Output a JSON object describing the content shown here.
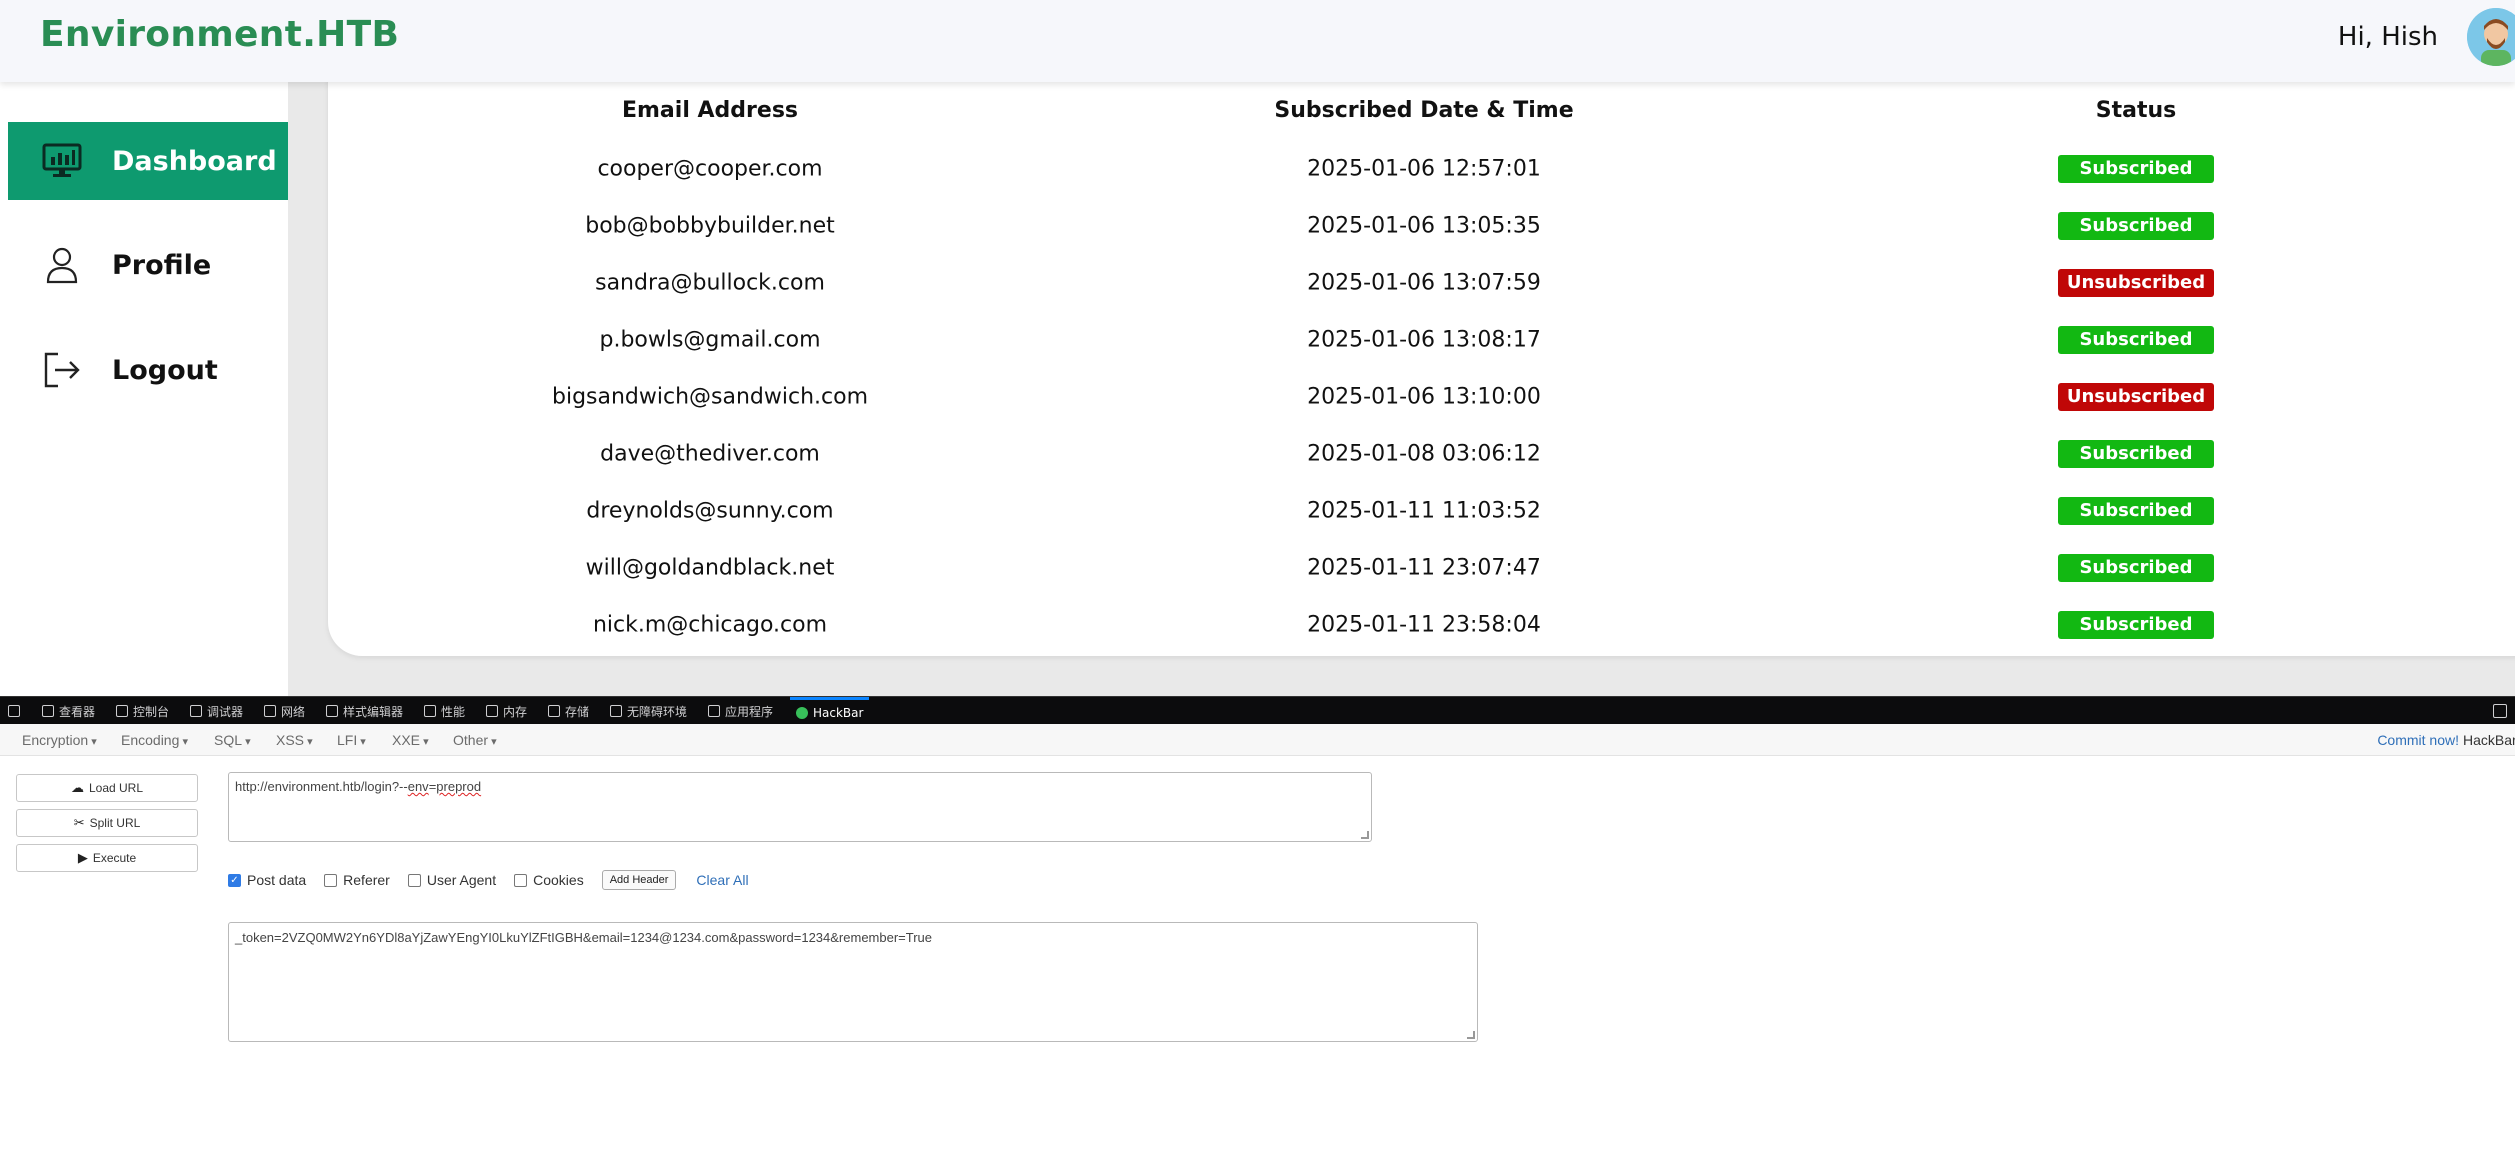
{
  "header": {
    "brand": "Environment.HTB",
    "greeting": "Hi, Hish"
  },
  "sidebar": {
    "items": [
      {
        "label": "Dashboard",
        "icon": "dashboard-monitor-icon",
        "active": true
      },
      {
        "label": "Profile",
        "icon": "user-icon",
        "active": false
      },
      {
        "label": "Logout",
        "icon": "logout-icon",
        "active": false
      }
    ]
  },
  "table": {
    "columns": [
      "Email Address",
      "Subscribed Date & Time",
      "Status"
    ],
    "rows": [
      {
        "email": "cooper@cooper.com",
        "date": "2025-01-06 12:57:01",
        "status": "Subscribed"
      },
      {
        "email": "bob@bobbybuilder.net",
        "date": "2025-01-06 13:05:35",
        "status": "Subscribed"
      },
      {
        "email": "sandra@bullock.com",
        "date": "2025-01-06 13:07:59",
        "status": "Unsubscribed"
      },
      {
        "email": "p.bowls@gmail.com",
        "date": "2025-01-06 13:08:17",
        "status": "Subscribed"
      },
      {
        "email": "bigsandwich@sandwich.com",
        "date": "2025-01-06 13:10:00",
        "status": "Unsubscribed"
      },
      {
        "email": "dave@thediver.com",
        "date": "2025-01-08 03:06:12",
        "status": "Subscribed"
      },
      {
        "email": "dreynolds@sunny.com",
        "date": "2025-01-11 11:03:52",
        "status": "Subscribed"
      },
      {
        "email": "will@goldandblack.net",
        "date": "2025-01-11 23:07:47",
        "status": "Subscribed"
      },
      {
        "email": "nick.m@chicago.com",
        "date": "2025-01-11 23:58:04",
        "status": "Subscribed"
      }
    ],
    "status_colors": {
      "Subscribed": "#12b812",
      "Unsubscribed": "#c00707"
    }
  },
  "devtools": {
    "tabs": [
      "查看器",
      "控制台",
      "调试器",
      "网络",
      "样式编辑器",
      "性能",
      "内存",
      "存储",
      "无障碍环境",
      "应用程序",
      "HackBar"
    ],
    "active_tab": "HackBar"
  },
  "hackbar": {
    "menu": [
      "Encryption",
      "Encoding",
      "SQL",
      "XSS",
      "LFI",
      "XXE",
      "Other"
    ],
    "commit": "Commit now!",
    "brand": "HackBar",
    "buttons": {
      "load": "Load URL",
      "split": "Split URL",
      "execute": "Execute"
    },
    "url_prefix": "http://environment.htb/login?--",
    "url_env": "env",
    "url_eq": "=",
    "url_val": "preprod",
    "options": {
      "post_data": "Post data",
      "referer": "Referer",
      "user_agent": "User Agent",
      "cookies": "Cookies"
    },
    "post_data_checked": true,
    "add_header": "Add Header",
    "clear_all": "Clear All",
    "post_body": "_token=2VZQ0MW2Yn6YDl8aYjZawYEngYI0LkuYlZFtIGBH&email=1234@1234.com&password=1234&remember=True"
  }
}
